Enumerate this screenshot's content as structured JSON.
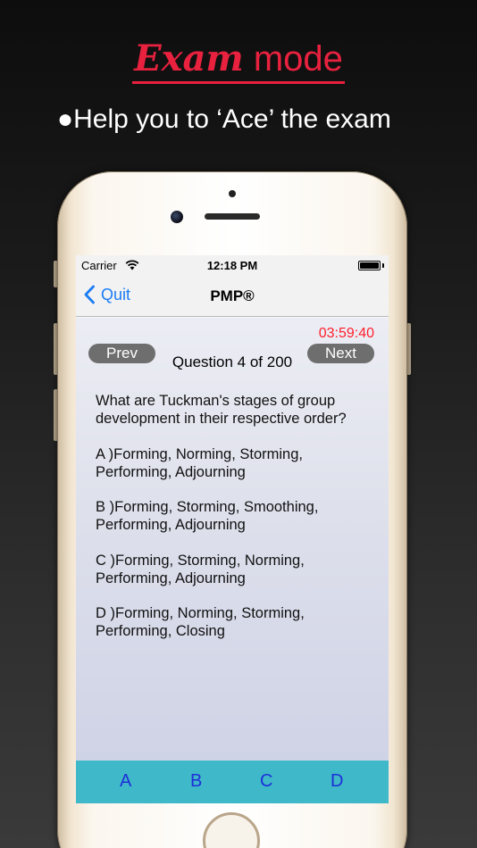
{
  "promo": {
    "title_script": "Exam",
    "title_plain": " mode",
    "subtitle": "●Help you to ‘Ace’ the exam"
  },
  "status_bar": {
    "carrier": "Carrier",
    "time": "12:18 PM"
  },
  "nav": {
    "back_label": "Quit",
    "title": "PMP®"
  },
  "exam": {
    "timer": "03:59:40",
    "prev_label": "Prev",
    "next_label": "Next",
    "counter": "Question 4 of 200",
    "question": "What are Tuckman's stages of group development in their respective order?",
    "options": [
      "A )Forming, Norming, Storming, Performing, Adjourning",
      "B )Forming, Storming, Smoothing, Performing, Adjourning",
      "C )Forming, Storming, Norming, Performing, Adjourning",
      "D )Forming, Norming, Storming, Performing, Closing"
    ],
    "answer_buttons": [
      "A",
      "B",
      "C",
      "D"
    ]
  },
  "colors": {
    "accent_red": "#e8213f",
    "ios_blue": "#1a7cf5",
    "answer_bar": "#3fb9c9",
    "timer_red": "#ff1f2d"
  }
}
